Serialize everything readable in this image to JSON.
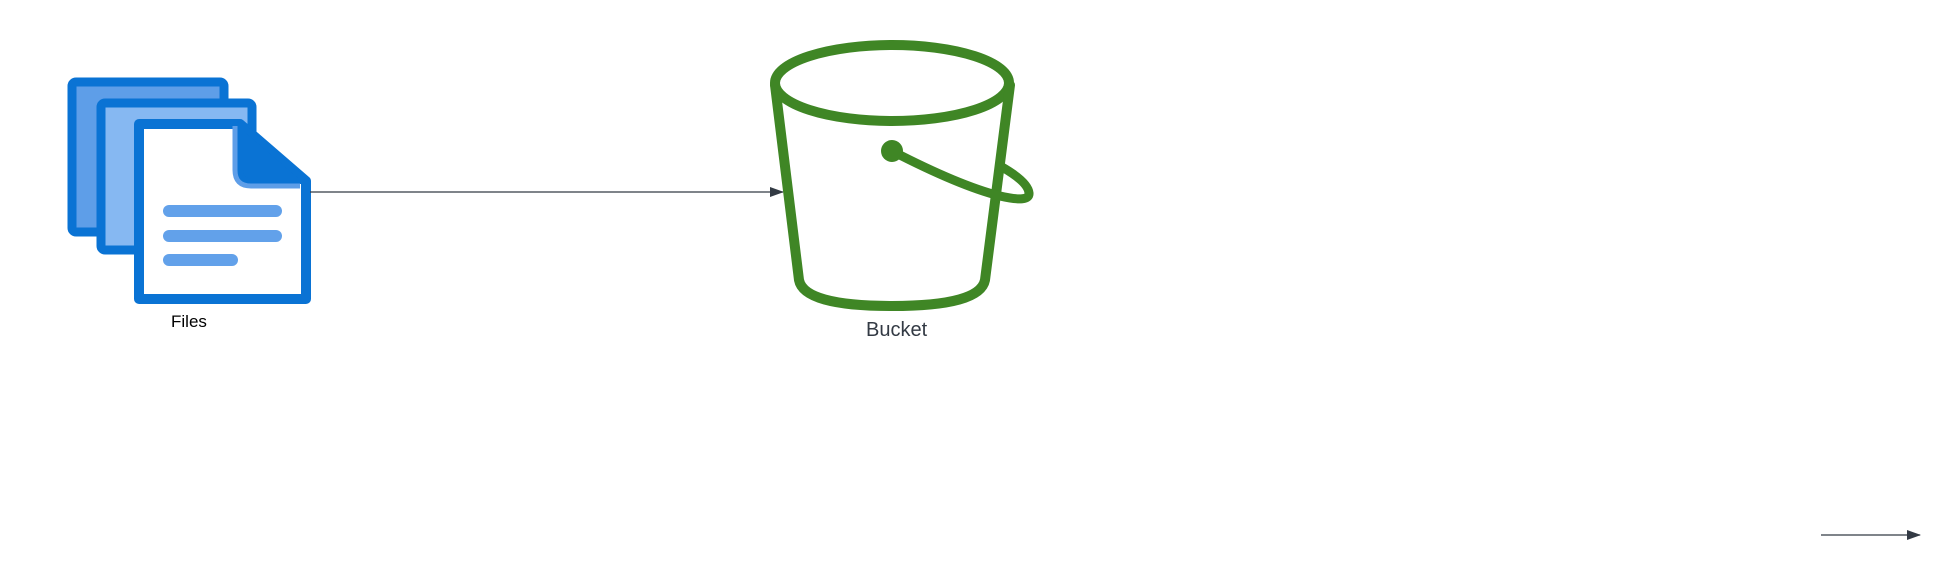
{
  "nodes": {
    "files": {
      "label": "Files",
      "icon": "files-icon",
      "colors": {
        "stroke": "#0a73d4",
        "back_fill": "#5e9ee8",
        "mid_fill": "#86b8f2",
        "front_fill": "#ffffff",
        "line_fill": "#62a1ea"
      }
    },
    "bucket": {
      "label": "Bucket",
      "icon": "bucket-icon",
      "colors": {
        "stroke": "#3f8625"
      }
    }
  },
  "edges": [
    {
      "from": "files",
      "to": "bucket",
      "color": "#333a44"
    }
  ],
  "legend_arrow": {
    "color": "#333a44"
  }
}
